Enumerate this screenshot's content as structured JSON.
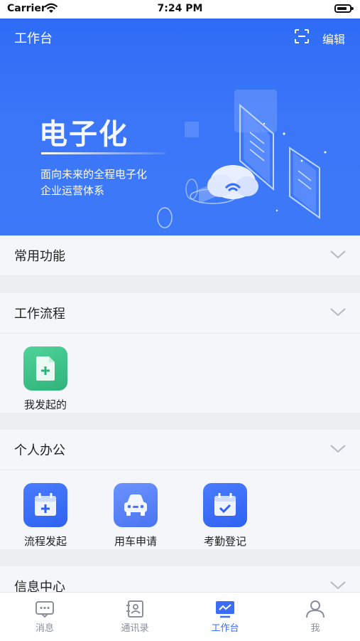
{
  "status_bar": {
    "carrier": "Carrier",
    "time": "7:24 PM"
  },
  "header": {
    "title": "工作台",
    "edit_label": "编辑"
  },
  "banner": {
    "big_title": "电子化",
    "subtitle_line1": "面向未来的全程电子化",
    "subtitle_line2": "企业运营体系"
  },
  "sections": {
    "common": {
      "title": "常用功能"
    },
    "workflow": {
      "title": "工作流程",
      "items": [
        {
          "label": "我发起的",
          "icon": "document-plus-icon",
          "color": "#3cc48a"
        }
      ]
    },
    "personal": {
      "title": "个人办公",
      "items": [
        {
          "label": "流程发起",
          "icon": "calendar-plus-icon",
          "color": "#3b6df6"
        },
        {
          "label": "用车申请",
          "icon": "car-icon",
          "color": "#4d7cf6"
        },
        {
          "label": "考勤登记",
          "icon": "calendar-check-icon",
          "color": "#3b6df6"
        }
      ]
    },
    "info": {
      "title": "信息中心"
    }
  },
  "tabbar": {
    "items": [
      {
        "label": "消息",
        "icon": "message-icon"
      },
      {
        "label": "通讯录",
        "icon": "contacts-icon"
      },
      {
        "label": "工作台",
        "icon": "workbench-icon",
        "active": true
      },
      {
        "label": "我",
        "icon": "user-icon"
      }
    ]
  },
  "colors": {
    "accent": "#3b6df6",
    "inactive": "#8a8f99"
  }
}
